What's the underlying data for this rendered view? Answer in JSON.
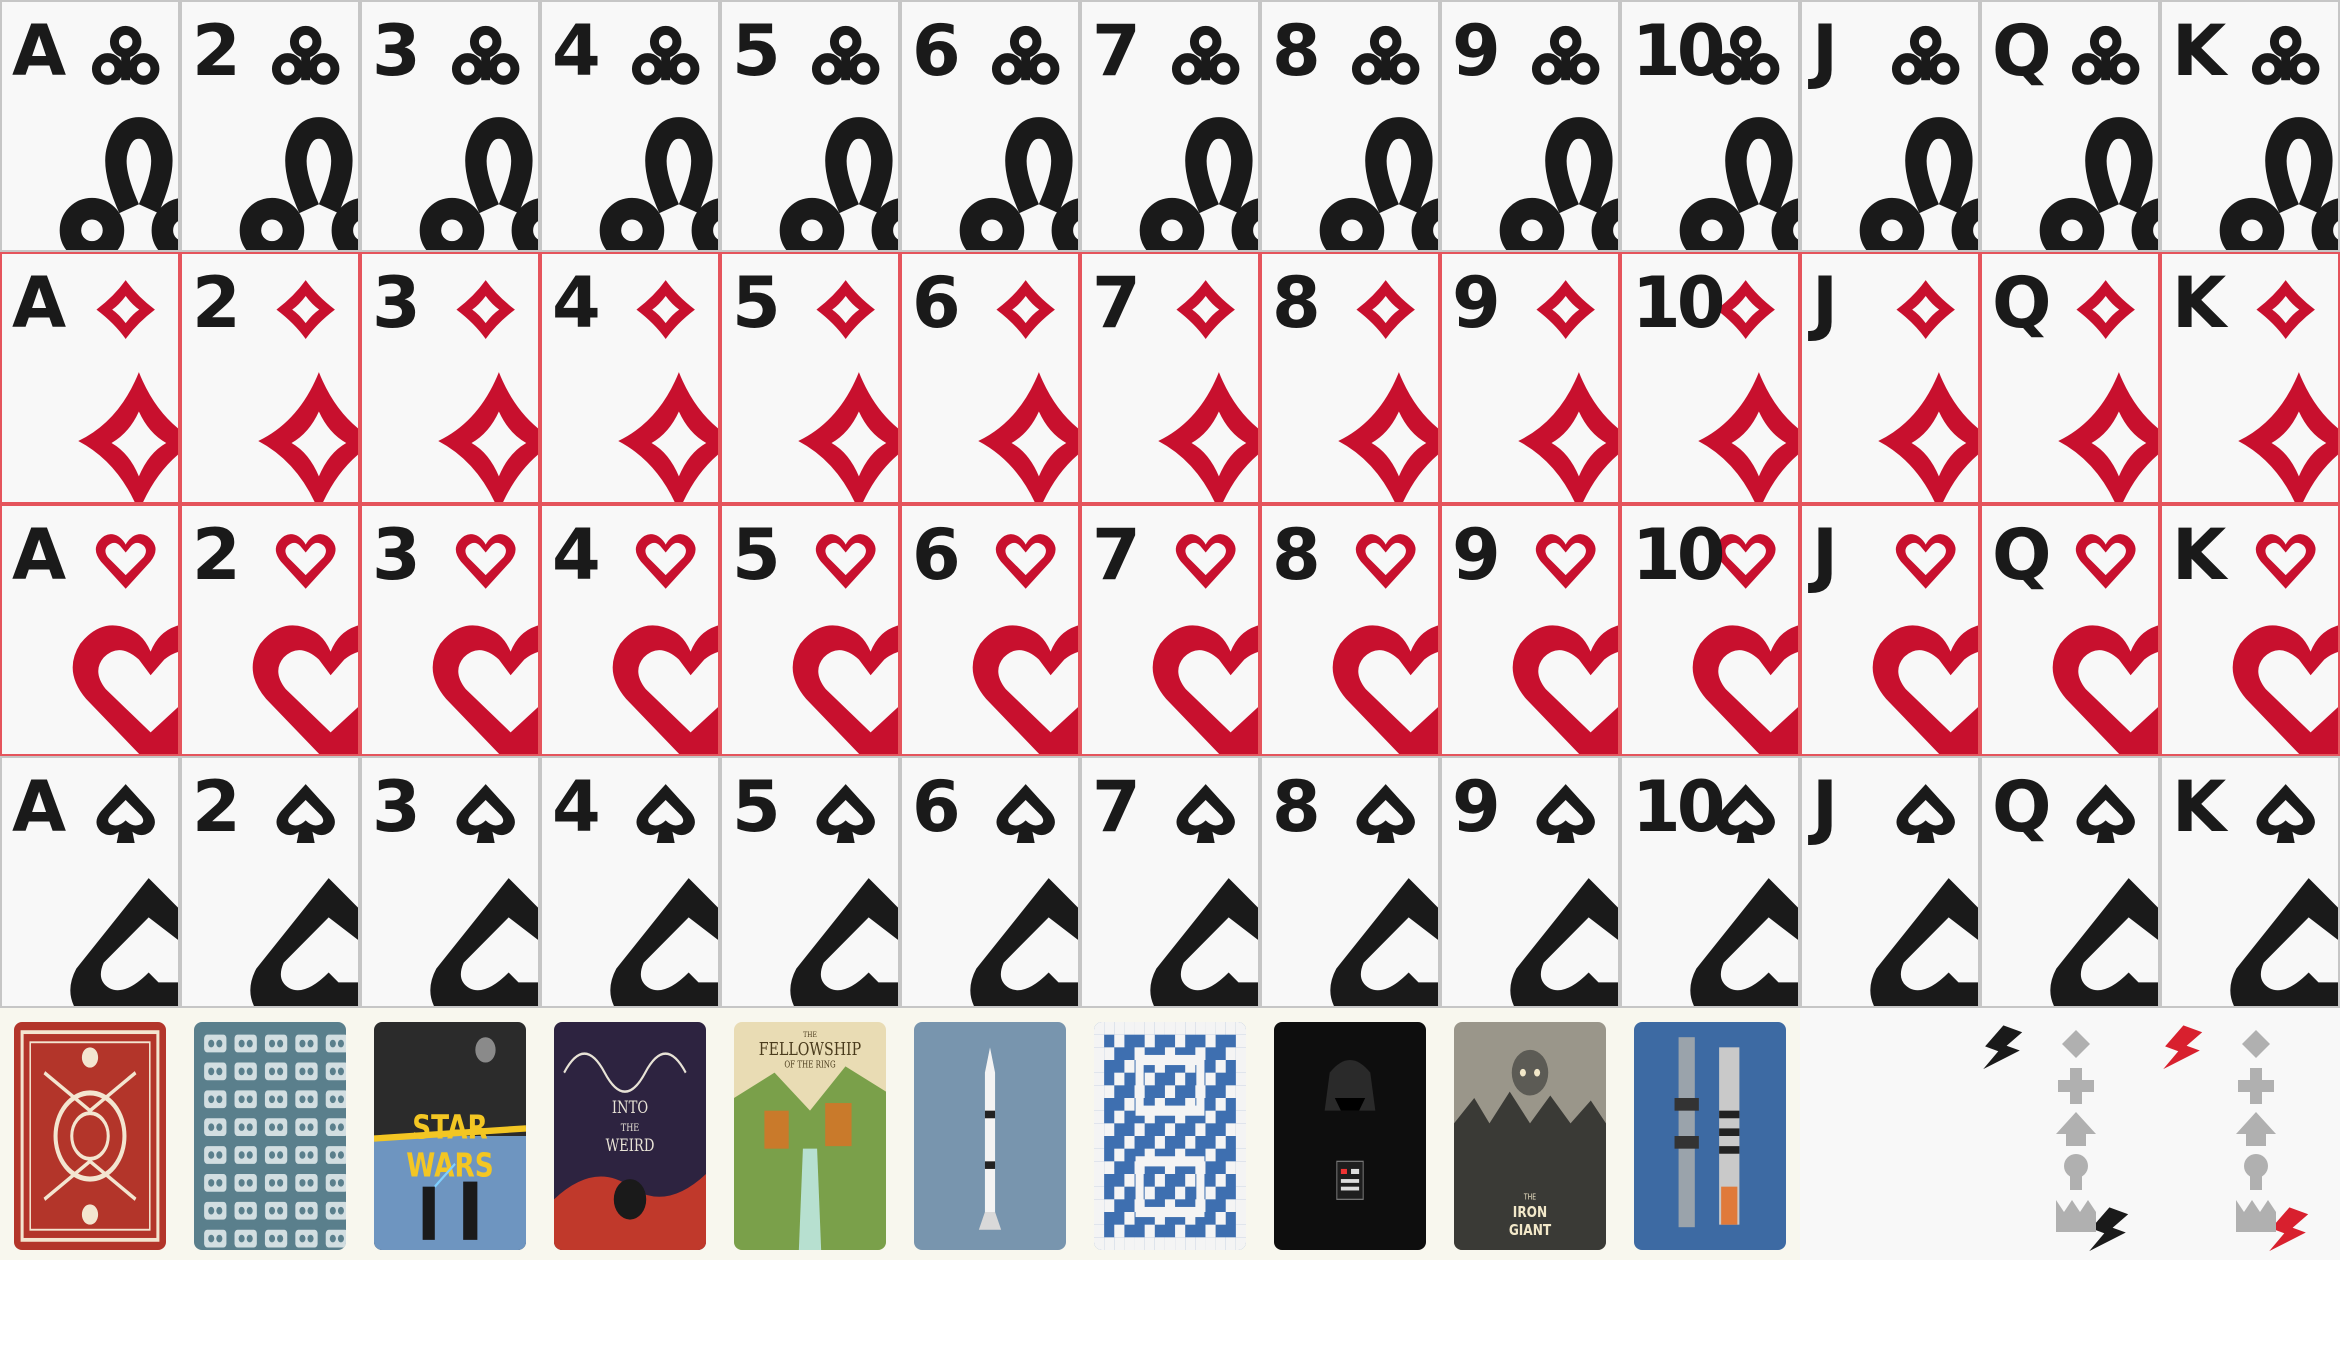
{
  "grid": {
    "ranks": [
      "A",
      "2",
      "3",
      "4",
      "5",
      "6",
      "7",
      "8",
      "9",
      "10",
      "J",
      "Q",
      "K"
    ],
    "suits": [
      {
        "name": "clubs",
        "color": "black",
        "pip_color": "#1a1a1a"
      },
      {
        "name": "diamonds",
        "color": "red",
        "pip_color": "#c8102e"
      },
      {
        "name": "hearts",
        "color": "red",
        "pip_color": "#c8102e"
      },
      {
        "name": "spades",
        "color": "black",
        "pip_color": "#1a1a1a"
      }
    ]
  },
  "backs": [
    {
      "name": "red-skull-back",
      "style": "ornate-red"
    },
    {
      "name": "cassette-pattern-back",
      "style": "blue-pattern"
    },
    {
      "name": "star-wars-poster-back",
      "style": "starwars",
      "title_top": "STAR",
      "title_bottom": "WARS"
    },
    {
      "name": "into-the-weird-back",
      "style": "weird",
      "title_top": "INTO",
      "title_mid": "THE",
      "title_bottom": "WEIRD"
    },
    {
      "name": "fellowship-back",
      "style": "fellowship",
      "title_small": "THE",
      "title_top": "FELLOWSHIP",
      "title_bottom": "OF THE RING"
    },
    {
      "name": "rocket-back",
      "style": "rocket"
    },
    {
      "name": "pixel-pattern-back",
      "style": "pixel"
    },
    {
      "name": "darth-vader-back",
      "style": "vader"
    },
    {
      "name": "iron-giant-back",
      "style": "irongiant",
      "title_small": "THE",
      "title_top": "IRON",
      "title_bottom": "GIANT"
    },
    {
      "name": "lightsaber-back",
      "style": "sabers"
    },
    {
      "name": "empty-slot",
      "style": "empty"
    }
  ],
  "jokers": [
    {
      "name": "black-joker",
      "bolt_color": "#1a1a1a"
    },
    {
      "name": "red-joker",
      "bolt_color": "#d8202e"
    }
  ],
  "colors": {
    "card_bg": "#f8f8f8",
    "black_border": "#c6c6c6",
    "red_border": "#e5545c",
    "back_bg": "#f8f7ee",
    "symbol_gray": "#b0b0b0"
  }
}
